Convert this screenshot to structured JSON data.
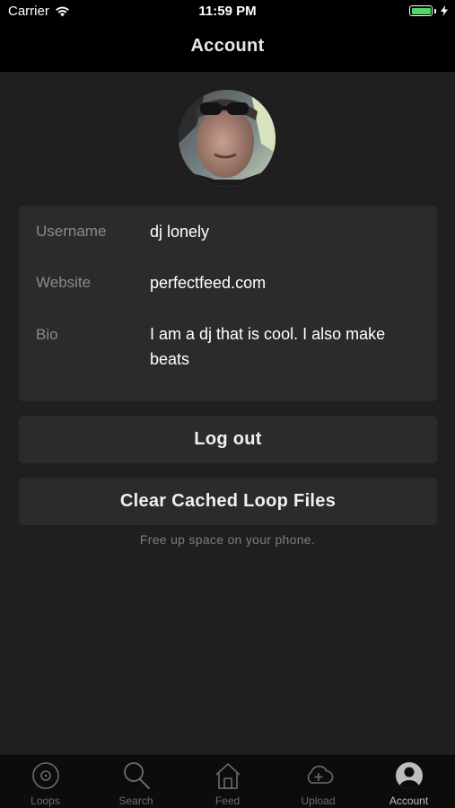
{
  "status_bar": {
    "carrier": "Carrier",
    "time": "11:59 PM",
    "battery_color": "#4cd964"
  },
  "nav": {
    "title": "Account"
  },
  "profile": {
    "avatar_icon": "user-photo",
    "fields": [
      {
        "label": "Username",
        "value": "dj lonely"
      },
      {
        "label": "Website",
        "value": "perfectfeed.com"
      },
      {
        "label": "Bio",
        "value": "I am a dj that is cool. I also make beats"
      }
    ]
  },
  "actions": {
    "logout_label": "Log out",
    "clear_cache_label": "Clear Cached Loop Files",
    "clear_cache_hint": "Free up space on your phone."
  },
  "tabbar": {
    "items": [
      {
        "label": "Loops",
        "icon": "loop-disc-icon"
      },
      {
        "label": "Search",
        "icon": "search-icon"
      },
      {
        "label": "Feed",
        "icon": "home-icon"
      },
      {
        "label": "Upload",
        "icon": "cloud-upload-icon"
      },
      {
        "label": "Account",
        "icon": "user-icon",
        "active": true
      }
    ]
  },
  "colors": {
    "background": "#1f1f1f",
    "card": "#2b2b2b",
    "topbar": "#000000",
    "tabbar": "#0c0c0c"
  }
}
